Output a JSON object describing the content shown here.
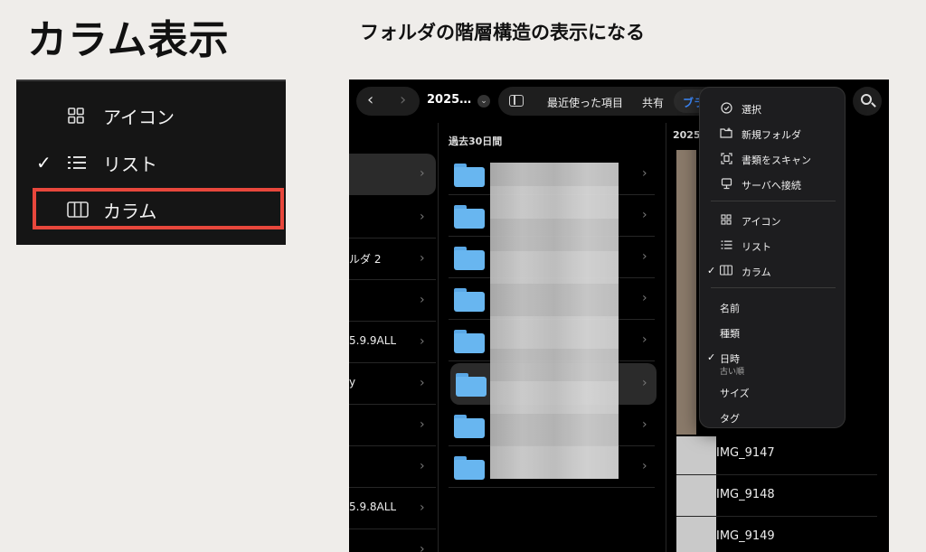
{
  "heading": "カラム表示",
  "caption": "フォルダの階層構造の表示になる",
  "zoom_menu": {
    "items": [
      {
        "label": "アイコン",
        "checked": false,
        "icon": "grid-icon"
      },
      {
        "label": "リスト",
        "checked": true,
        "icon": "list-icon"
      },
      {
        "label": "カラム",
        "checked": false,
        "icon": "columns-icon",
        "highlighted": true
      }
    ],
    "check_mark": "✓",
    "highlight_color": "#e8473c"
  },
  "finder": {
    "nav": {
      "back": "‹",
      "forward": "›"
    },
    "path_title": "2025…",
    "path_chevron": "⌄",
    "tabs": {
      "recent": "最近使った項目",
      "shared": "共有",
      "active": "ブラ"
    },
    "accent_color": "#3d8bff",
    "col1_rows": [
      {
        "text": ""
      },
      {
        "text": ""
      },
      {
        "text": "ルダ 2"
      },
      {
        "text": ""
      },
      {
        "text": "5.9.9ALL"
      },
      {
        "text": "y"
      },
      {
        "text": ""
      },
      {
        "text": ""
      },
      {
        "text": "5.9.8ALL"
      },
      {
        "text": ""
      }
    ],
    "col2_header": "過去30日間",
    "col3_header": "2025",
    "img_rows": [
      "IMG_9147",
      "IMG_9148",
      "IMG_9149"
    ],
    "chevron": "›"
  },
  "menu": {
    "actions": [
      {
        "label": "選択",
        "icon": "checkmark-circle-icon"
      },
      {
        "label": "新規フォルダ",
        "icon": "new-folder-icon"
      },
      {
        "label": "書類をスキャン",
        "icon": "scan-document-icon"
      },
      {
        "label": "サーバへ接続",
        "icon": "server-icon"
      }
    ],
    "views": [
      {
        "label": "アイコン",
        "icon": "grid-icon",
        "checked": false
      },
      {
        "label": "リスト",
        "icon": "list-icon",
        "checked": false
      },
      {
        "label": "カラム",
        "icon": "columns-icon",
        "checked": true
      }
    ],
    "sorts": [
      {
        "label": "名前",
        "checked": false,
        "sub": ""
      },
      {
        "label": "種類",
        "checked": false,
        "sub": ""
      },
      {
        "label": "日時",
        "checked": true,
        "sub": "古い順"
      },
      {
        "label": "サイズ",
        "checked": false,
        "sub": ""
      },
      {
        "label": "タグ",
        "checked": false,
        "sub": ""
      }
    ],
    "check_mark": "✓"
  }
}
